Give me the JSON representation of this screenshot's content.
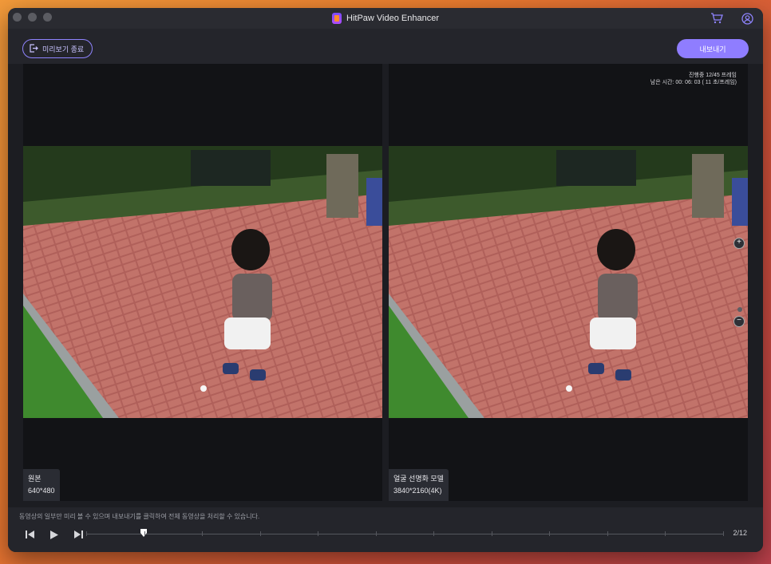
{
  "window": {
    "title": "HitPaw Video Enhancer",
    "icons": [
      "cart-icon",
      "user-icon"
    ]
  },
  "toolbar": {
    "exit_preview_label": "미리보기 종료",
    "export_label": "내보내기"
  },
  "left_panel": {
    "label": "원본",
    "resolution": "640*480"
  },
  "right_panel": {
    "label": "얼굴 선명화 모델",
    "resolution": "3840*2160(4K)",
    "progress_line1": "진행중 12/45 프레임",
    "progress_line2": "남은 시간: 00: 06: 03 ( 11 초/프레임)"
  },
  "bottom": {
    "hint": "동영상의 일부만 미리 볼 수 있으며 내보내기를 클릭하여 전체 동영상을 처리할 수 있습니다.",
    "page_counter": "2/12",
    "timeline_position_fraction": 0.09
  },
  "colors": {
    "accent": "#8f7dff",
    "window_bg": "#1c1d22"
  }
}
